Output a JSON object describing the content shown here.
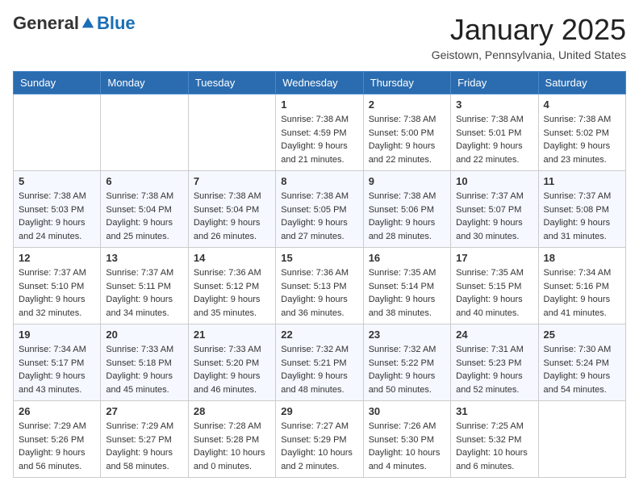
{
  "header": {
    "logo_general": "General",
    "logo_blue": "Blue",
    "month": "January 2025",
    "location": "Geistown, Pennsylvania, United States"
  },
  "weekdays": [
    "Sunday",
    "Monday",
    "Tuesday",
    "Wednesday",
    "Thursday",
    "Friday",
    "Saturday"
  ],
  "weeks": [
    [
      {
        "day": "",
        "info": ""
      },
      {
        "day": "",
        "info": ""
      },
      {
        "day": "",
        "info": ""
      },
      {
        "day": "1",
        "info": "Sunrise: 7:38 AM\nSunset: 4:59 PM\nDaylight: 9 hours\nand 21 minutes."
      },
      {
        "day": "2",
        "info": "Sunrise: 7:38 AM\nSunset: 5:00 PM\nDaylight: 9 hours\nand 22 minutes."
      },
      {
        "day": "3",
        "info": "Sunrise: 7:38 AM\nSunset: 5:01 PM\nDaylight: 9 hours\nand 22 minutes."
      },
      {
        "day": "4",
        "info": "Sunrise: 7:38 AM\nSunset: 5:02 PM\nDaylight: 9 hours\nand 23 minutes."
      }
    ],
    [
      {
        "day": "5",
        "info": "Sunrise: 7:38 AM\nSunset: 5:03 PM\nDaylight: 9 hours\nand 24 minutes."
      },
      {
        "day": "6",
        "info": "Sunrise: 7:38 AM\nSunset: 5:04 PM\nDaylight: 9 hours\nand 25 minutes."
      },
      {
        "day": "7",
        "info": "Sunrise: 7:38 AM\nSunset: 5:04 PM\nDaylight: 9 hours\nand 26 minutes."
      },
      {
        "day": "8",
        "info": "Sunrise: 7:38 AM\nSunset: 5:05 PM\nDaylight: 9 hours\nand 27 minutes."
      },
      {
        "day": "9",
        "info": "Sunrise: 7:38 AM\nSunset: 5:06 PM\nDaylight: 9 hours\nand 28 minutes."
      },
      {
        "day": "10",
        "info": "Sunrise: 7:37 AM\nSunset: 5:07 PM\nDaylight: 9 hours\nand 30 minutes."
      },
      {
        "day": "11",
        "info": "Sunrise: 7:37 AM\nSunset: 5:08 PM\nDaylight: 9 hours\nand 31 minutes."
      }
    ],
    [
      {
        "day": "12",
        "info": "Sunrise: 7:37 AM\nSunset: 5:10 PM\nDaylight: 9 hours\nand 32 minutes."
      },
      {
        "day": "13",
        "info": "Sunrise: 7:37 AM\nSunset: 5:11 PM\nDaylight: 9 hours\nand 34 minutes."
      },
      {
        "day": "14",
        "info": "Sunrise: 7:36 AM\nSunset: 5:12 PM\nDaylight: 9 hours\nand 35 minutes."
      },
      {
        "day": "15",
        "info": "Sunrise: 7:36 AM\nSunset: 5:13 PM\nDaylight: 9 hours\nand 36 minutes."
      },
      {
        "day": "16",
        "info": "Sunrise: 7:35 AM\nSunset: 5:14 PM\nDaylight: 9 hours\nand 38 minutes."
      },
      {
        "day": "17",
        "info": "Sunrise: 7:35 AM\nSunset: 5:15 PM\nDaylight: 9 hours\nand 40 minutes."
      },
      {
        "day": "18",
        "info": "Sunrise: 7:34 AM\nSunset: 5:16 PM\nDaylight: 9 hours\nand 41 minutes."
      }
    ],
    [
      {
        "day": "19",
        "info": "Sunrise: 7:34 AM\nSunset: 5:17 PM\nDaylight: 9 hours\nand 43 minutes."
      },
      {
        "day": "20",
        "info": "Sunrise: 7:33 AM\nSunset: 5:18 PM\nDaylight: 9 hours\nand 45 minutes."
      },
      {
        "day": "21",
        "info": "Sunrise: 7:33 AM\nSunset: 5:20 PM\nDaylight: 9 hours\nand 46 minutes."
      },
      {
        "day": "22",
        "info": "Sunrise: 7:32 AM\nSunset: 5:21 PM\nDaylight: 9 hours\nand 48 minutes."
      },
      {
        "day": "23",
        "info": "Sunrise: 7:32 AM\nSunset: 5:22 PM\nDaylight: 9 hours\nand 50 minutes."
      },
      {
        "day": "24",
        "info": "Sunrise: 7:31 AM\nSunset: 5:23 PM\nDaylight: 9 hours\nand 52 minutes."
      },
      {
        "day": "25",
        "info": "Sunrise: 7:30 AM\nSunset: 5:24 PM\nDaylight: 9 hours\nand 54 minutes."
      }
    ],
    [
      {
        "day": "26",
        "info": "Sunrise: 7:29 AM\nSunset: 5:26 PM\nDaylight: 9 hours\nand 56 minutes."
      },
      {
        "day": "27",
        "info": "Sunrise: 7:29 AM\nSunset: 5:27 PM\nDaylight: 9 hours\nand 58 minutes."
      },
      {
        "day": "28",
        "info": "Sunrise: 7:28 AM\nSunset: 5:28 PM\nDaylight: 10 hours\nand 0 minutes."
      },
      {
        "day": "29",
        "info": "Sunrise: 7:27 AM\nSunset: 5:29 PM\nDaylight: 10 hours\nand 2 minutes."
      },
      {
        "day": "30",
        "info": "Sunrise: 7:26 AM\nSunset: 5:30 PM\nDaylight: 10 hours\nand 4 minutes."
      },
      {
        "day": "31",
        "info": "Sunrise: 7:25 AM\nSunset: 5:32 PM\nDaylight: 10 hours\nand 6 minutes."
      },
      {
        "day": "",
        "info": ""
      }
    ]
  ]
}
